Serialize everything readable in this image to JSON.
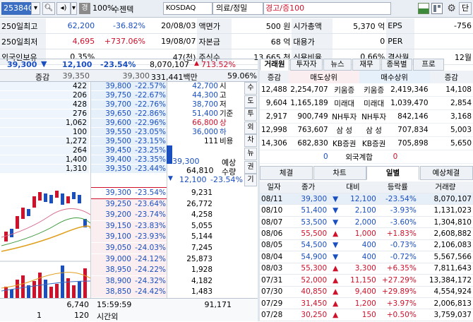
{
  "toolbar": {
    "code": "253840",
    "rate": "100%",
    "name": "수젠텍",
    "market": "KOSDAQ",
    "sector": "의료/정밀",
    "warning": "경고/증100",
    "gyeong_badge": "경",
    "right_label": "단"
  },
  "info": [
    [
      "250일최고",
      "62,200",
      "-36.82%",
      "20/08/03",
      "액면가",
      "500 원",
      "시가총액",
      "5,370 억",
      "EPS",
      "-756"
    ],
    [
      "250일최저",
      "4,695",
      "+737.06%",
      "19/08/07",
      "자본금",
      "68 억",
      "대용가",
      "0",
      "PER",
      ""
    ],
    [
      "외국인보유",
      "0.35%",
      "",
      "47(천)",
      "주식수",
      "13,665 천",
      "신용비율",
      "0.66%",
      "결산월",
      "12월"
    ]
  ],
  "priceline": {
    "price": "39,300",
    "change": "12,100",
    "rate": "-23.54%",
    "volume": "8,070,107",
    "vol_ratio": "713.52%"
  },
  "obhead": {
    "label": "증감",
    "left_val": "39,350",
    "mid_val": "39,300",
    "amount": "331,441백만",
    "pct": "59.06%"
  },
  "asks": [
    [
      "422",
      "39,800",
      "-22.57%"
    ],
    [
      "206",
      "39,750",
      "-22.67%"
    ],
    [
      "428",
      "39,700",
      "-22.76%"
    ],
    [
      "276",
      "39,650",
      "-22.86%"
    ],
    [
      "1,062",
      "39,600",
      "-22.96%"
    ],
    [
      "100",
      "39,550",
      "-23.05%"
    ],
    [
      "1,272",
      "39,500",
      "-23.15%"
    ],
    [
      "264",
      "39,450",
      "-23.25%"
    ],
    [
      "1,400",
      "39,400",
      "-23.35%"
    ],
    [
      "1,310",
      "39,350",
      "-23.44%"
    ]
  ],
  "bids": [
    [
      "39,300",
      "-23.54%",
      "9,231"
    ],
    [
      "39,250",
      "-23.64%",
      "26,772"
    ],
    [
      "39,200",
      "-23.74%",
      "4,258"
    ],
    [
      "39,150",
      "-23.83%",
      "5,055"
    ],
    [
      "39,100",
      "-23.93%",
      "5,144"
    ],
    [
      "39,050",
      "-24.03%",
      "7,245"
    ],
    [
      "39,000",
      "-24.12%",
      "25,873"
    ],
    [
      "38,950",
      "-24.22%",
      "1,928"
    ],
    [
      "38,900",
      "-24.32%",
      "4,182"
    ],
    [
      "38,850",
      "-24.42%",
      "1,483"
    ]
  ],
  "side_info": [
    [
      "42,700",
      "시"
    ],
    [
      "44,300",
      "고"
    ],
    [
      "38,700",
      "저"
    ],
    [
      "51,400",
      "기준"
    ],
    [
      "66,800",
      "상"
    ],
    [
      "36,000",
      "하"
    ],
    [
      "111",
      "비용"
    ]
  ],
  "expected": {
    "price_label": "예상",
    "price": "39,300",
    "qty_label": "수량",
    "qty": "64,810",
    "change": "12,100",
    "rate": "-23.54%"
  },
  "vtabs": [
    "수",
    "도",
    "투",
    "외",
    "차",
    "뉴",
    "권",
    "기"
  ],
  "ob_footer": {
    "ask_total": "6,740",
    "time": "15:59:59",
    "bid_total": "91,171",
    "after_left": "1",
    "after_mid": "120",
    "after_label": "시간외"
  },
  "broker_tabs": [
    "거래원",
    "투자자",
    "뉴스",
    "재무",
    "종목별",
    "프로"
  ],
  "broker_head": [
    "증감",
    "매도상위",
    "매수상위",
    "증감"
  ],
  "brokers": [
    [
      "12,488",
      "2,254,707",
      "키움증",
      "키움증",
      "2,419,346",
      "14,108"
    ],
    [
      "9,604",
      "1,165,189",
      "미래대",
      "미래대",
      "1,039,470",
      "2,854"
    ],
    [
      "2,917",
      "900,749",
      "NH투자",
      "NH투자",
      "842,146",
      "3,168"
    ],
    [
      "12,998",
      "763,607",
      "삼 성",
      "삼 성",
      "707,834",
      "5,003"
    ],
    [
      "14,306",
      "682,830",
      "KB증권",
      "KB증권",
      "705,898",
      "5,650"
    ]
  ],
  "foreign_total": {
    "left": "0",
    "label": "외국계합",
    "right": "0"
  },
  "bottom_tabs": [
    "체결",
    "차트",
    "일별",
    "예상체결"
  ],
  "daily_head": [
    "일자",
    "종가",
    "대비",
    "등락률",
    "거래량"
  ],
  "daily": [
    [
      "08/11",
      "39,300",
      "dn",
      "12,100",
      "-23.54%",
      "8,070,107"
    ],
    [
      "08/10",
      "51,400",
      "dn",
      "2,100",
      "-3.93%",
      "1,131,023"
    ],
    [
      "08/07",
      "53,500",
      "dn",
      "2,000",
      "-3.60%",
      "1,304,810"
    ],
    [
      "08/06",
      "55,500",
      "up",
      "1,000",
      "+1.83%",
      "2,608,882"
    ],
    [
      "08/05",
      "54,500",
      "dn",
      "400",
      "-0.73%",
      "2,106,083"
    ],
    [
      "08/04",
      "54,900",
      "dn",
      "400",
      "-0.72%",
      "5,567,566"
    ],
    [
      "08/03",
      "55,300",
      "up",
      "3,300",
      "+6.35%",
      "7,811,643"
    ],
    [
      "07/31",
      "52,000",
      "up",
      "11,150",
      "+27.29%",
      "13,384,172"
    ],
    [
      "07/30",
      "40,850",
      "up",
      "9,400",
      "+29.89%",
      "4,554,924"
    ],
    [
      "07/29",
      "31,450",
      "up",
      "1,200",
      "+3.97%",
      "2,006,813"
    ],
    [
      "07/28",
      "30,250",
      "up",
      "150",
      "+0.50%",
      "3,759,037"
    ]
  ],
  "colors": {
    "up": "#d0112b",
    "down": "#1a4fc0",
    "ask_bg": "#e6f0fb",
    "bid_bg": "#fbeef0",
    "accent": "#3a6fc4"
  }
}
